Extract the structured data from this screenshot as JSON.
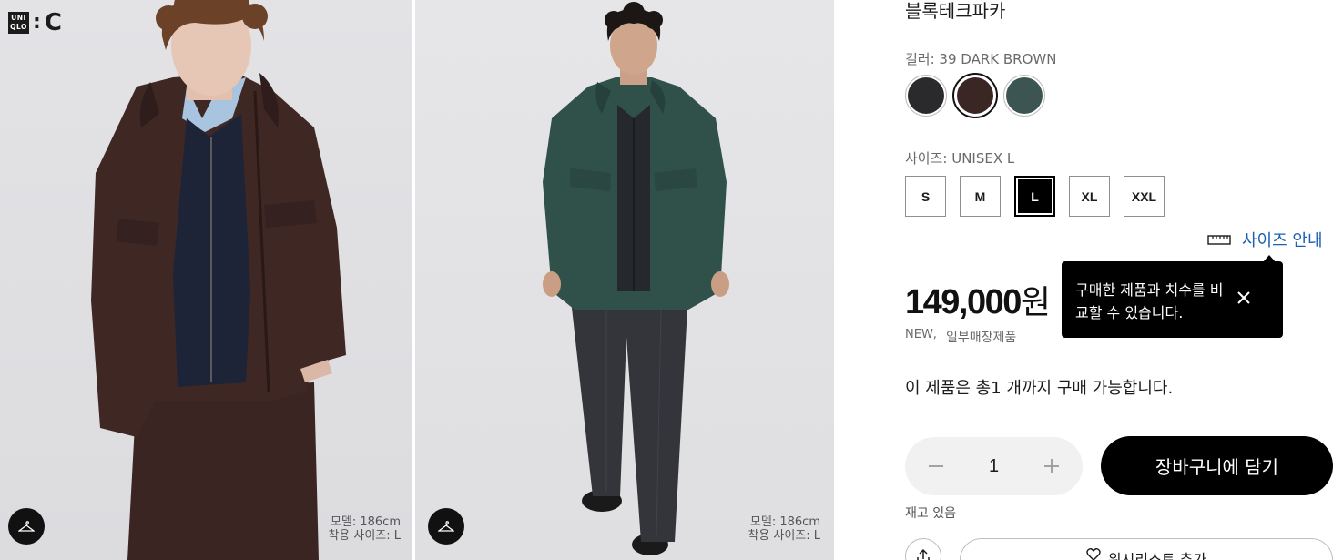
{
  "brand": {
    "logo_box_text": "UNI QLO",
    "logo_suffix": "C"
  },
  "gallery": {
    "photo_1": {
      "model_height": "모델: 186cm",
      "model_size": "착용 사이즈: L"
    },
    "photo_2": {
      "model_height": "모델: 186cm",
      "model_size": "착용 사이즈: L"
    }
  },
  "product": {
    "title": "블록테크파카",
    "color_label": "컬러: 39 DARK BROWN",
    "colors": [
      {
        "name": "black",
        "hex": "#2a2a2c",
        "selected": false
      },
      {
        "name": "dark-brown",
        "hex": "#3a2623",
        "selected": true
      },
      {
        "name": "dark-green",
        "hex": "#3c5552",
        "selected": false
      }
    ],
    "size_label": "사이즈: UNISEX L",
    "sizes": [
      "S",
      "M",
      "L",
      "XL",
      "XXL"
    ],
    "selected_size": "L",
    "size_guide": "사이즈 안내",
    "tooltip": "구매한 제품과 치수를 비교할 수 있습니다.",
    "price": "149,000",
    "currency": "원",
    "flag_new": "NEW,",
    "flag_store": "일부매장제품",
    "purchase_limit": "이 제품은 총1 개까지 구매 가능합니다.",
    "quantity": "1",
    "add_to_cart": "장바구니에 담기",
    "stock": "재고 있음",
    "wishlist": "위시리스트 추가"
  }
}
